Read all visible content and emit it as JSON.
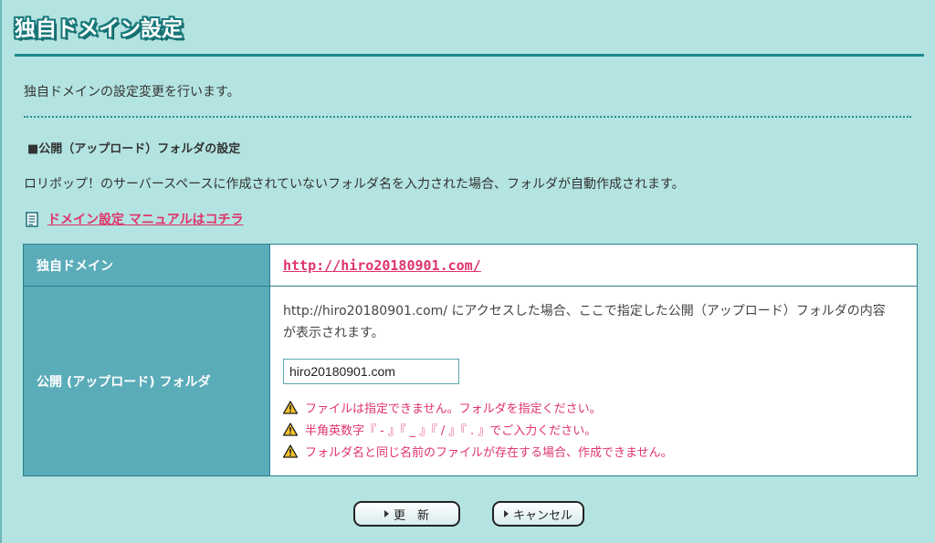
{
  "page_title": "独自ドメイン設定",
  "intro": "独自ドメインの設定変更を行います。",
  "section_heading": "■公開（アップロード）フォルダの設定",
  "description": "ロリポップ！のサーバースペースに作成されていないフォルダ名を入力された場合、フォルダが自動作成されます。",
  "manual_link": "ドメイン設定 マニュアルはコチラ",
  "table": {
    "domain_label": "独自ドメイン",
    "domain_value": "http://hiro20180901.com/",
    "folder_label": "公開 (アップロード) フォルダ",
    "folder_description": "http://hiro20180901.com/ にアクセスした場合、ここで指定した公開（アップロード）フォルダの内容が表示されます。",
    "folder_input_value": "hiro20180901.com",
    "warnings": [
      "ファイルは指定できません。フォルダを指定ください。",
      "半角英数字『 - 』『 _ 』『 / 』『 . 』でご入力ください。",
      "フォルダ名と同じ名前のファイルが存在する場合、作成できません。"
    ]
  },
  "buttons": {
    "update": "更　新",
    "cancel": "キャンセル"
  },
  "colors": {
    "background": "#b3e4e1",
    "accent": "#1b8a8c",
    "link": "#e0336a",
    "table_label_bg": "#5aacb9"
  },
  "icons": {
    "manual": "document-icon",
    "warning": "warning-icon"
  }
}
